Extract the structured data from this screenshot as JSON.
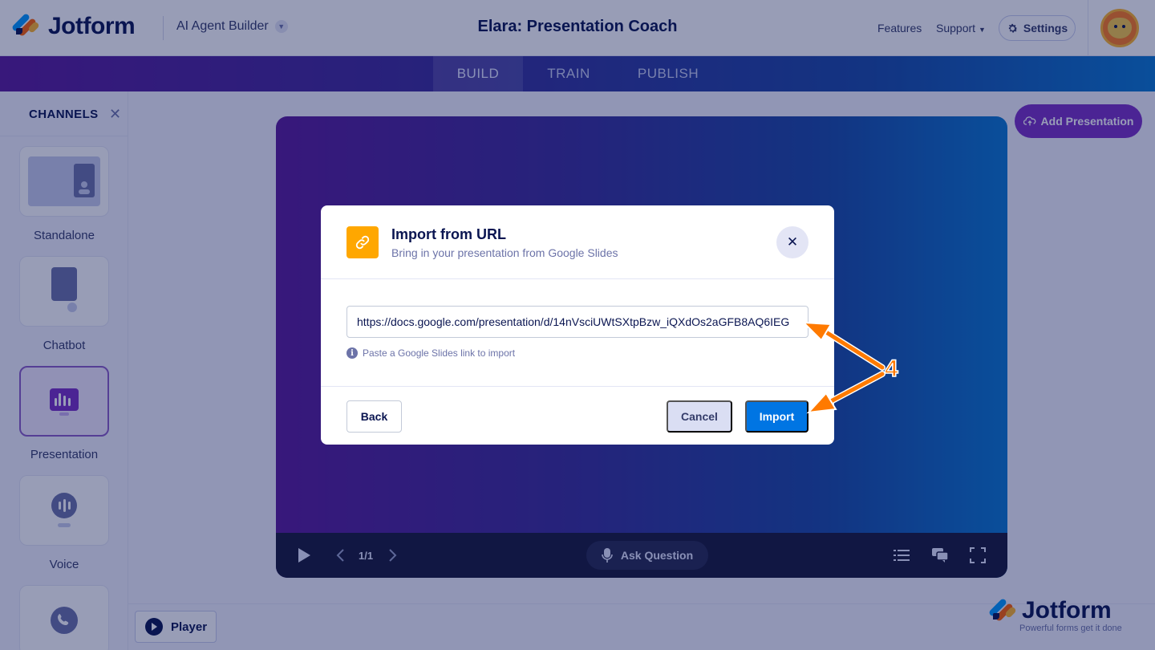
{
  "header": {
    "logo_text": "Jotform",
    "product_label": "AI Agent Builder",
    "agent_title": "Elara: Presentation Coach",
    "features_label": "Features",
    "support_label": "Support",
    "settings_label": "Settings"
  },
  "tabs": [
    {
      "label": "BUILD",
      "active": true
    },
    {
      "label": "TRAIN",
      "active": false
    },
    {
      "label": "PUBLISH",
      "active": false
    }
  ],
  "sidebar": {
    "title": "CHANNELS",
    "items": [
      {
        "label": "Standalone",
        "active": false
      },
      {
        "label": "Chatbot",
        "active": false
      },
      {
        "label": "Presentation",
        "active": true
      },
      {
        "label": "Voice",
        "active": false
      },
      {
        "label": "",
        "active": false
      }
    ]
  },
  "stage": {
    "add_presentation_label": "Add Presentation",
    "slide_counter": "1/1",
    "ask_question_label": "Ask Question"
  },
  "bottom": {
    "player_label": "Player",
    "watermark_text": "Jotform",
    "watermark_tagline": "Powerful forms get it done"
  },
  "modal": {
    "title": "Import from URL",
    "subtitle": "Bring in your presentation from Google Slides",
    "url_value": "https://docs.google.com/presentation/d/14nVsciUWtSXtpBzw_iQXdOs2aGFB8AQ6IEG",
    "hint": "Paste a Google Slides link to import",
    "back_label": "Back",
    "cancel_label": "Cancel",
    "import_label": "Import"
  },
  "annotation": {
    "step_number": "4",
    "color": "#ff7a00"
  },
  "colors": {
    "brand_navy": "#0a1551",
    "accent_purple": "#7a2fc4",
    "primary_blue": "#0075e3",
    "link_icon_orange": "#ffa700"
  }
}
